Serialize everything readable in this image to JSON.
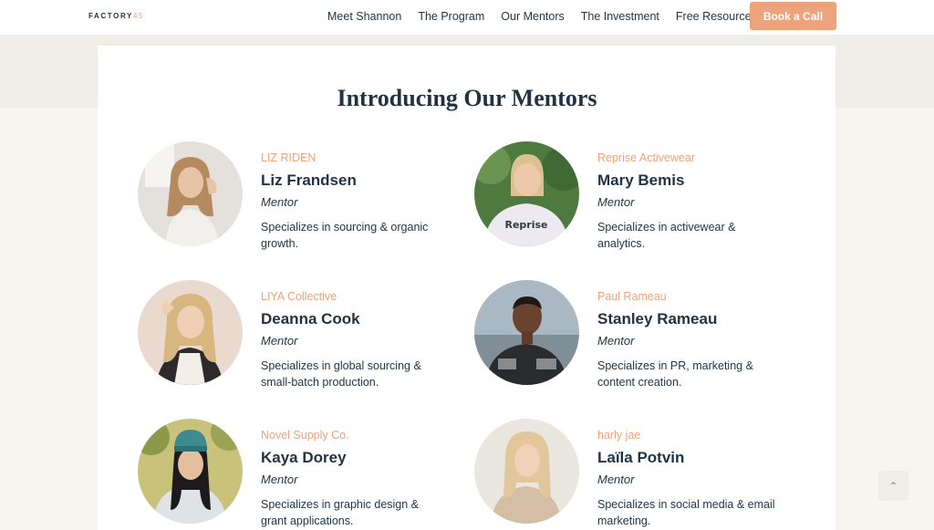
{
  "header": {
    "logo_text": "FACTORY",
    "logo_number": "45",
    "nav": [
      {
        "label": "Meet Shannon"
      },
      {
        "label": "The Program"
      },
      {
        "label": "Our Mentors"
      },
      {
        "label": "The Investment"
      },
      {
        "label": "Free Resources"
      }
    ],
    "cta_label": "Book a Call"
  },
  "section": {
    "title": "Introducing Our Mentors"
  },
  "mentors": [
    {
      "company": "LIZ RIDEN",
      "name": "Liz Frandsen",
      "role": "Mentor",
      "description": "Specializes in sourcing & organic growth."
    },
    {
      "company": "Reprise Activewear",
      "name": "Mary Bemis",
      "role": "Mentor",
      "description": "Specializes in activewear & analytics.",
      "shirt_text": "Reprise"
    },
    {
      "company": "LIYA Collective",
      "name": "Deanna Cook",
      "role": "Mentor",
      "description": "Specializes in global sourcing & small-batch production."
    },
    {
      "company": "Paul Rameau",
      "name": "Stanley Rameau",
      "role": "Mentor",
      "description": "Specializes in PR, marketing & content creation."
    },
    {
      "company": "Novel Supply Co.",
      "name": "Kaya Dorey",
      "role": "Mentor",
      "description": "Specializes in graphic design & grant applications."
    },
    {
      "company": "harly jae",
      "name": "Laïla Potvin",
      "role": "Mentor",
      "description": "Specializes in social media & email marketing."
    }
  ],
  "scroll_top_icon": "chevron-up-icon",
  "colors": {
    "accent": "#eda37b",
    "navy": "#1f3345",
    "band": "#efede8",
    "background": "#f7f5f0"
  }
}
